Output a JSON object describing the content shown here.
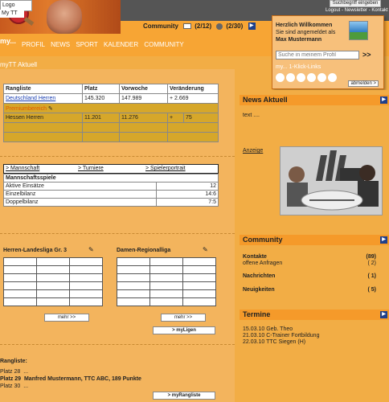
{
  "header": {
    "logo_text": "Logo",
    "mytt_text": "My TT",
    "search_button": "Suchbegriff eingeben",
    "top_links": "Logout - Newsletter - Kontakt",
    "community_label": "Community",
    "mail_count": "(2/12)",
    "user_count": "(2/30)"
  },
  "nav": {
    "brand": "my...",
    "items": [
      "PROFIL",
      "NEWS",
      "SPORT",
      "KALENDER",
      "COMMUNITY"
    ]
  },
  "welcome": {
    "title": "Herzlich Willkommen",
    "line2": "Sie sind angemeldet als",
    "name": "Max Mustermann",
    "search_placeholder": "Suche in meinem Profil",
    "go": ">>",
    "links_label": "my... 1-Klick-Links",
    "logout": "abmelden >"
  },
  "section_title": "myTT Aktuell",
  "ranking_table": {
    "headers": [
      "Rangliste",
      "Platz",
      "Vorwoche",
      "Veränderung"
    ],
    "row1": [
      "Deutschland Herren",
      "145.320",
      "147.989",
      "+ 2.669"
    ],
    "premium": "Premiumbereich",
    "row2": [
      "Hessen Herren",
      "11.201",
      "11.276",
      "+",
      "75"
    ]
  },
  "tabs": [
    "> Mannschaft",
    "> Turniere",
    "> Spielerportrait"
  ],
  "team_table": {
    "title": "Mannschaftsspiele",
    "rows": [
      {
        "label": "Aktive Einsätze",
        "value": "12"
      },
      {
        "label": "Einzelbilanz",
        "value": "14:6"
      },
      {
        "label": "Doppelbilanz",
        "value": "7:5"
      }
    ]
  },
  "leagues": {
    "left_title": "Herren-Landesliga Gr. 3",
    "right_title": "Damen-Regionalliga",
    "more": "mehr >>",
    "my_leagues": "> myLigen"
  },
  "rangliste": {
    "title": "Rangliste:",
    "lines": [
      {
        "place": "Platz 28",
        "text": "..."
      },
      {
        "place": "Platz 29",
        "text": "Manfred Mustermann, TTC ABC, 189 Punkte"
      },
      {
        "place": "Platz 30",
        "text": "..."
      }
    ],
    "button": "> myRangliste"
  },
  "right": {
    "news_title": "News Aktuell",
    "news_text": "text ....",
    "ad_label": "Anzeige",
    "community_title": "Community",
    "kontakte_label": "Kontakte",
    "kontakte_count": "(89)",
    "anfragen_label": "offene Anfragen",
    "anfragen_count": "( 2)",
    "nachrichten_label": "Nachrichten",
    "nachrichten_count": "( 1)",
    "neuigkeiten_label": "Neuigkeiten",
    "neuigkeiten_count": "( 5)",
    "termine_title": "Termine",
    "termine": [
      "15.03.10 Geb. Theo",
      "21.03.10 C-Trainer Fortbildung",
      "22.03.10 TTC Siegen (H)"
    ]
  }
}
